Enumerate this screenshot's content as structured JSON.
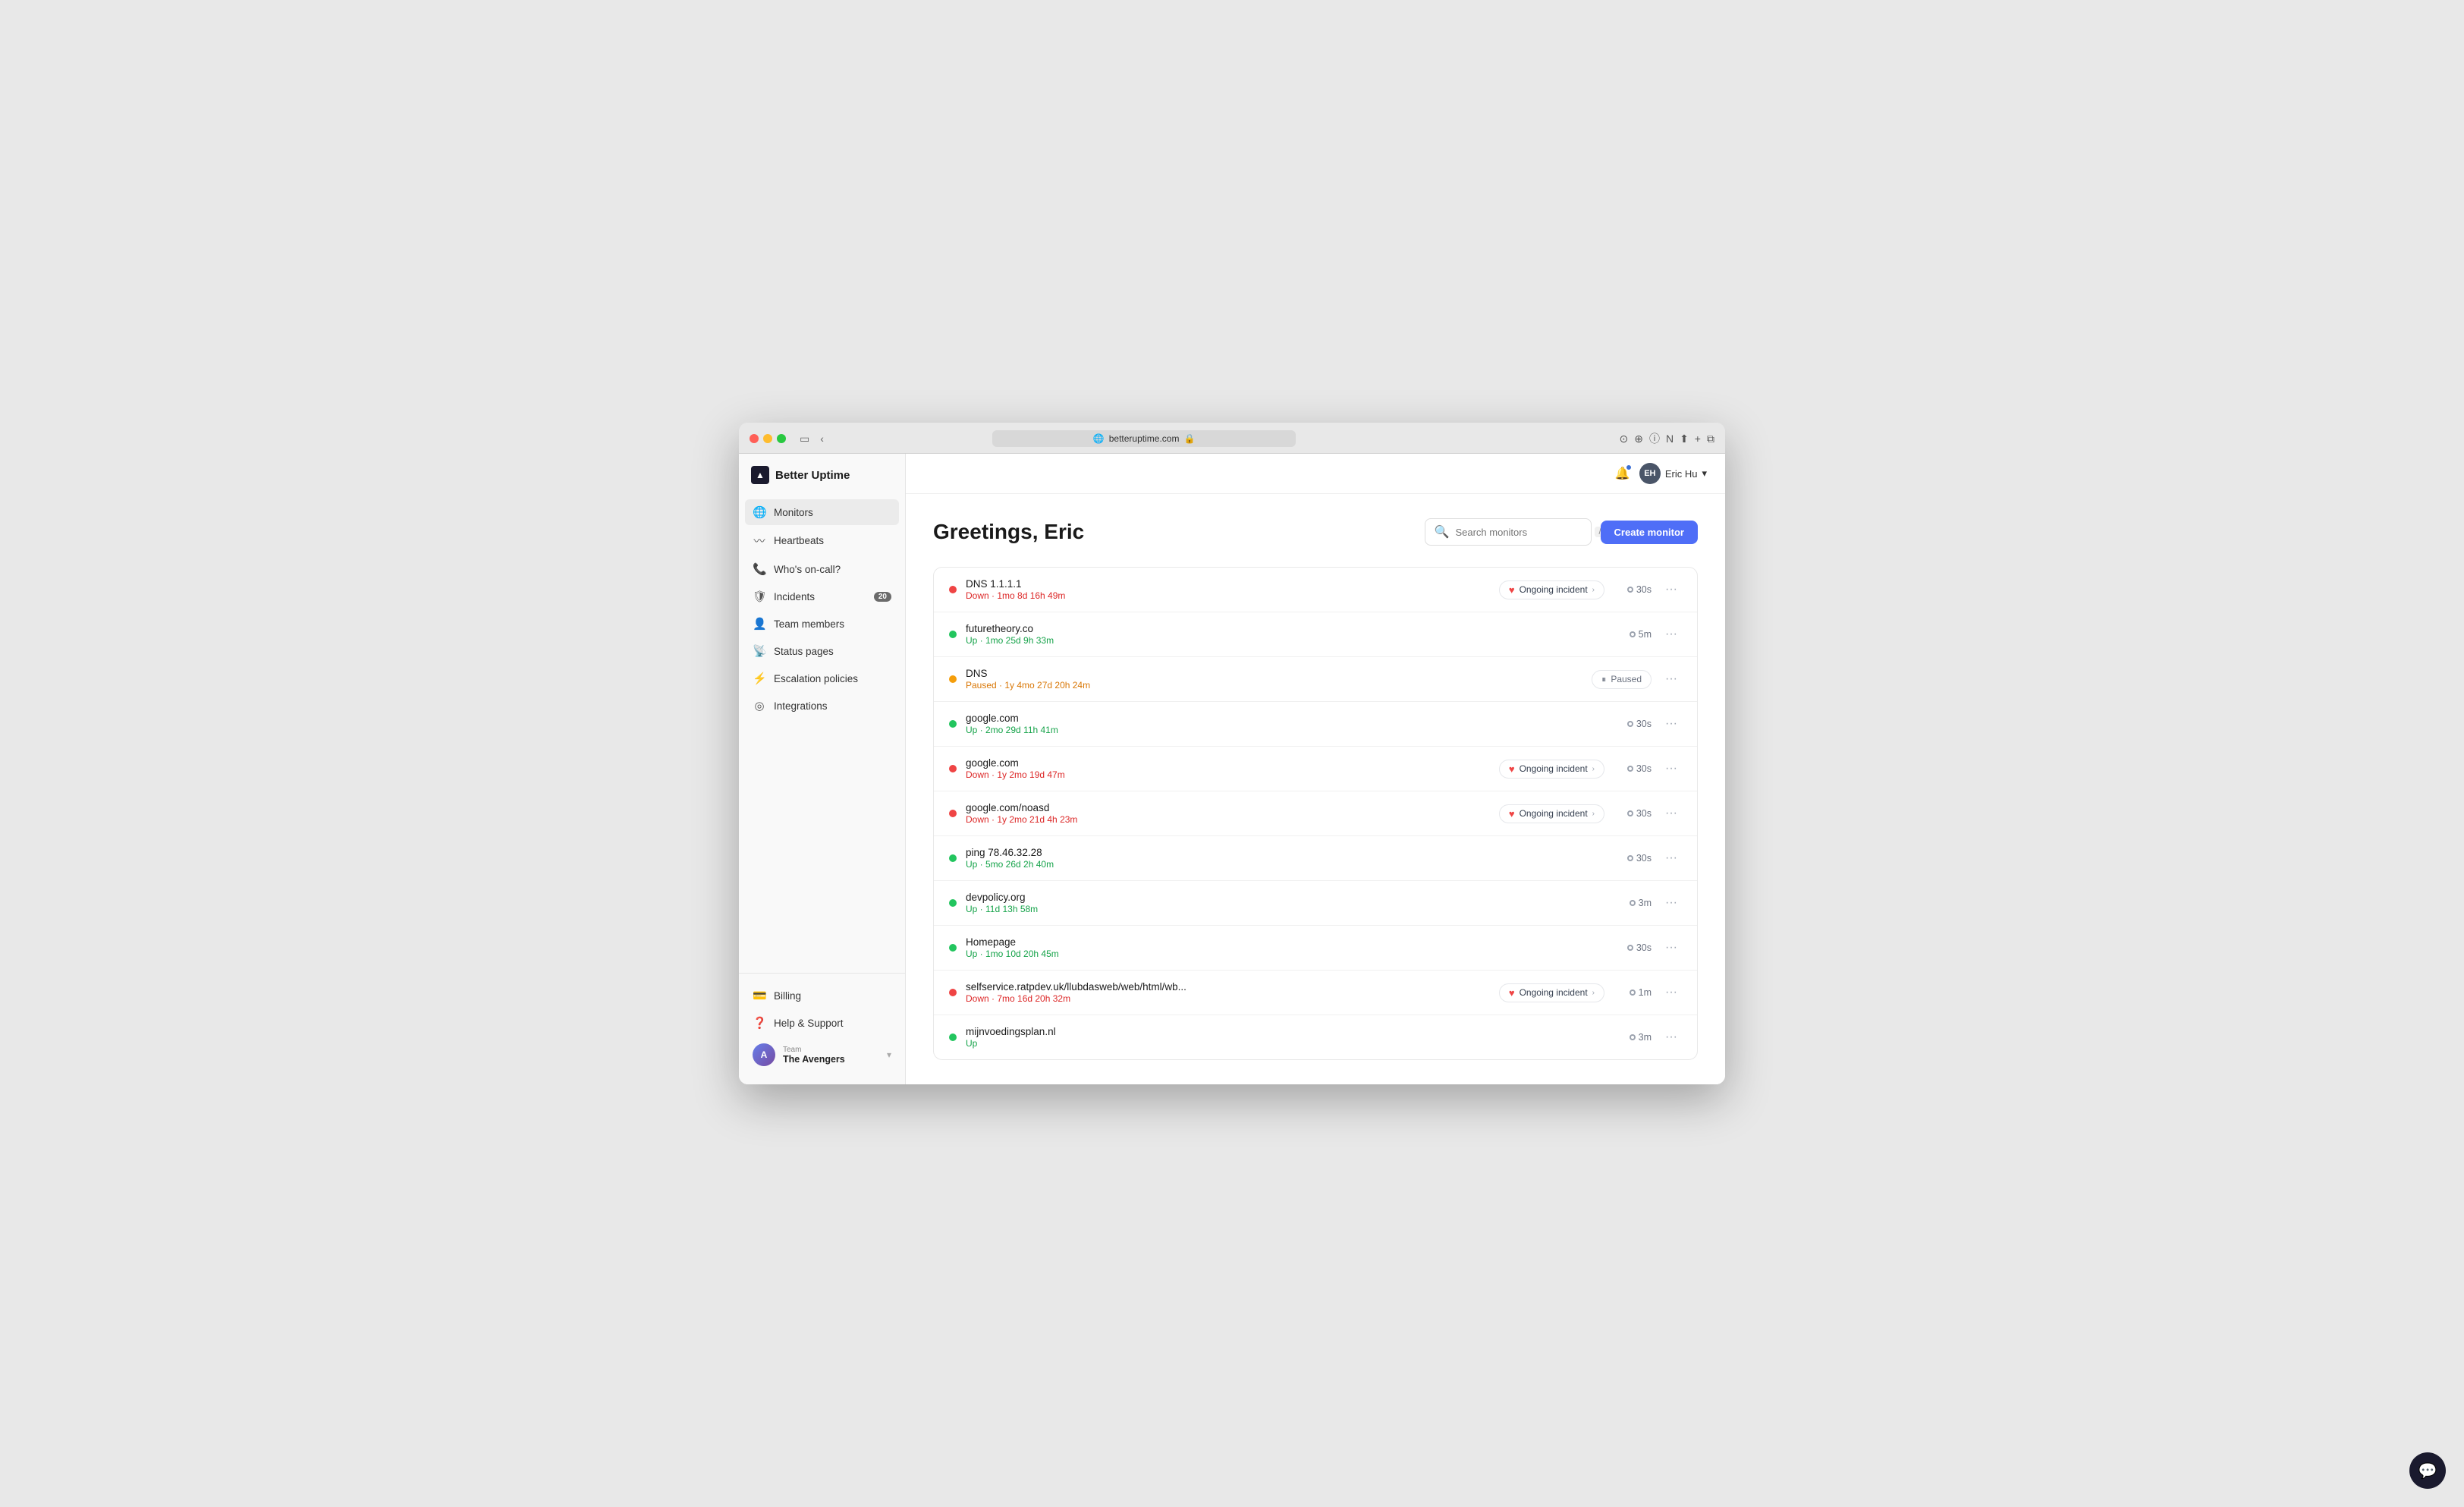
{
  "browser": {
    "url": "betteruptime.com",
    "lock_icon": "🔒"
  },
  "app": {
    "title": "Better Uptime",
    "logo_char": "▲"
  },
  "user": {
    "initials": "EH",
    "name": "Eric Hu"
  },
  "sidebar": {
    "nav_items": [
      {
        "id": "monitors",
        "label": "Monitors",
        "icon": "🌐",
        "active": true,
        "badge": null
      },
      {
        "id": "heartbeats",
        "label": "Heartbeats",
        "icon": "〰",
        "active": false,
        "badge": null
      },
      {
        "id": "whos-on-call",
        "label": "Who's on-call?",
        "icon": "📞",
        "active": false,
        "badge": null
      },
      {
        "id": "incidents",
        "label": "Incidents",
        "icon": "🛡",
        "active": false,
        "badge": "20"
      },
      {
        "id": "team-members",
        "label": "Team members",
        "icon": "👤",
        "active": false,
        "badge": null
      },
      {
        "id": "status-pages",
        "label": "Status pages",
        "icon": "📡",
        "active": false,
        "badge": null
      },
      {
        "id": "escalation-policies",
        "label": "Escalation policies",
        "icon": "⚡",
        "active": false,
        "badge": null
      },
      {
        "id": "integrations",
        "label": "Integrations",
        "icon": "◎",
        "active": false,
        "badge": null
      }
    ],
    "bottom_items": [
      {
        "id": "billing",
        "label": "Billing",
        "icon": "💳"
      },
      {
        "id": "help-support",
        "label": "Help & Support",
        "icon": "❓"
      }
    ],
    "team": {
      "label": "Team",
      "name": "The Avengers",
      "initials": "A"
    }
  },
  "page": {
    "greeting": "Greetings, Eric",
    "search_placeholder": "Search monitors",
    "create_button": "Create monitor"
  },
  "monitors": [
    {
      "name": "DNS 1.1.1.1",
      "status": "down",
      "status_text": "Down · 1mo 8d 16h 49m",
      "incident": "Ongoing incident",
      "interval": "30s"
    },
    {
      "name": "futuretheory.co",
      "status": "up",
      "status_text": "Up · 1mo 25d 9h 33m",
      "incident": null,
      "interval": "5m"
    },
    {
      "name": "DNS",
      "status": "paused",
      "status_text": "Paused · 1y 4mo 27d 20h 24m",
      "incident": "paused",
      "interval": null
    },
    {
      "name": "google.com",
      "status": "up",
      "status_text": "Up · 2mo 29d 11h 41m",
      "incident": null,
      "interval": "30s"
    },
    {
      "name": "google.com",
      "status": "down",
      "status_text": "Down · 1y 2mo 19d 47m",
      "incident": "Ongoing incident",
      "interval": "30s"
    },
    {
      "name": "google.com/noasd",
      "status": "down",
      "status_text": "Down · 1y 2mo 21d 4h 23m",
      "incident": "Ongoing incident",
      "interval": "30s"
    },
    {
      "name": "ping 78.46.32.28",
      "status": "up",
      "status_text": "Up · 5mo 26d 2h 40m",
      "incident": null,
      "interval": "30s"
    },
    {
      "name": "devpolicy.org",
      "status": "up",
      "status_text": "Up · 11d 13h 58m",
      "incident": null,
      "interval": "3m"
    },
    {
      "name": "Homepage",
      "status": "up",
      "status_text": "Up · 1mo 10d 20h 45m",
      "incident": null,
      "interval": "30s"
    },
    {
      "name": "selfservice.ratpdev.uk/llubdasweb/web/html/wb...",
      "status": "down",
      "status_text": "Down · 7mo 16d 20h 32m",
      "incident": "Ongoing incident",
      "interval": "1m"
    },
    {
      "name": "mijnvoedingsplan.nl",
      "status": "up",
      "status_text": "Up",
      "incident": null,
      "interval": "3m"
    }
  ]
}
